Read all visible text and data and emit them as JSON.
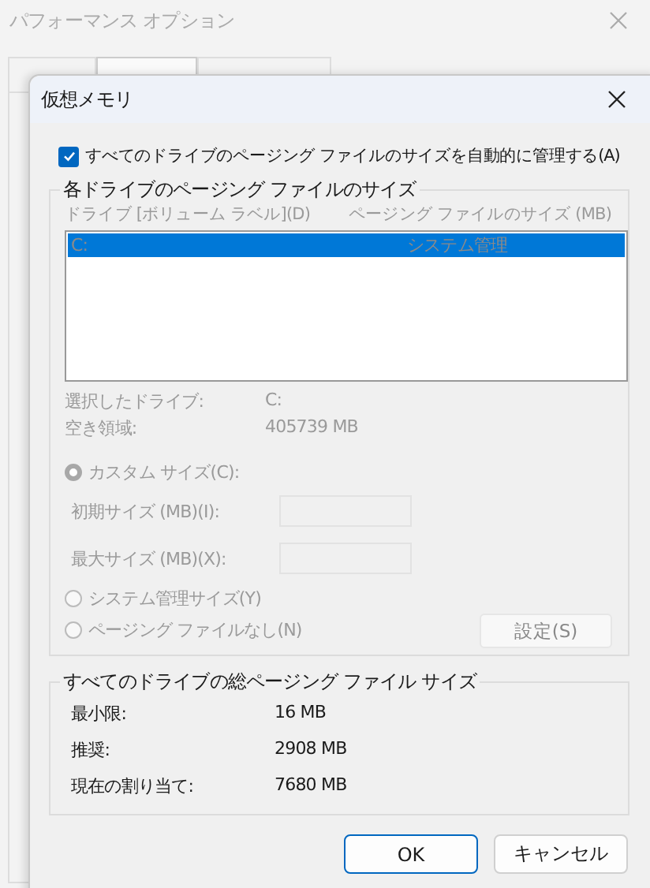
{
  "parent_window": {
    "title": "パフォーマンス オプション",
    "tabs": [
      {
        "selected": false
      },
      {
        "selected": true
      },
      {
        "selected": false
      }
    ]
  },
  "dialog": {
    "title": "仮想メモリ",
    "auto_manage": {
      "label": "すべてのドライブのページング ファイルのサイズを自動的に管理する(A)",
      "checked": true
    },
    "drive_group": {
      "title": "各ドライブのページング ファイルのサイズ",
      "disabled": true,
      "columns": [
        "ドライブ [ボリューム ラベル](D)",
        "ページング ファイルのサイズ (MB)"
      ],
      "rows": [
        {
          "drive": "C:",
          "size": "システム管理",
          "selected": true
        }
      ],
      "info": [
        {
          "label": "選択したドライブ:",
          "value": "C:"
        },
        {
          "label": "空き領域:",
          "value": "405739 MB"
        }
      ],
      "options": [
        {
          "kind": "radio",
          "label": "カスタム サイズ(C):",
          "selected": true
        },
        {
          "kind": "size_field",
          "label": "初期サイズ (MB)(I):"
        },
        {
          "kind": "size_field",
          "label": "最大サイズ (MB)(X):"
        },
        {
          "kind": "radio",
          "label": "システム管理サイズ(Y)",
          "selected": false
        },
        {
          "kind": "radio",
          "label": "ページング ファイルなし(N)",
          "selected": false
        }
      ],
      "set_button": {
        "label": "設定(S)"
      }
    },
    "totals": {
      "title": "すべてのドライブの総ページング ファイル サイズ",
      "rows": [
        {
          "label": "最小限:",
          "value": "16 MB"
        },
        {
          "label": "推奨:",
          "value": "2908 MB"
        },
        {
          "label": "現在の割り当て:",
          "value": "7680 MB"
        }
      ]
    },
    "buttons": [
      {
        "label": "OK",
        "default": true
      },
      {
        "label": "キャンセル",
        "default": false
      }
    ]
  }
}
